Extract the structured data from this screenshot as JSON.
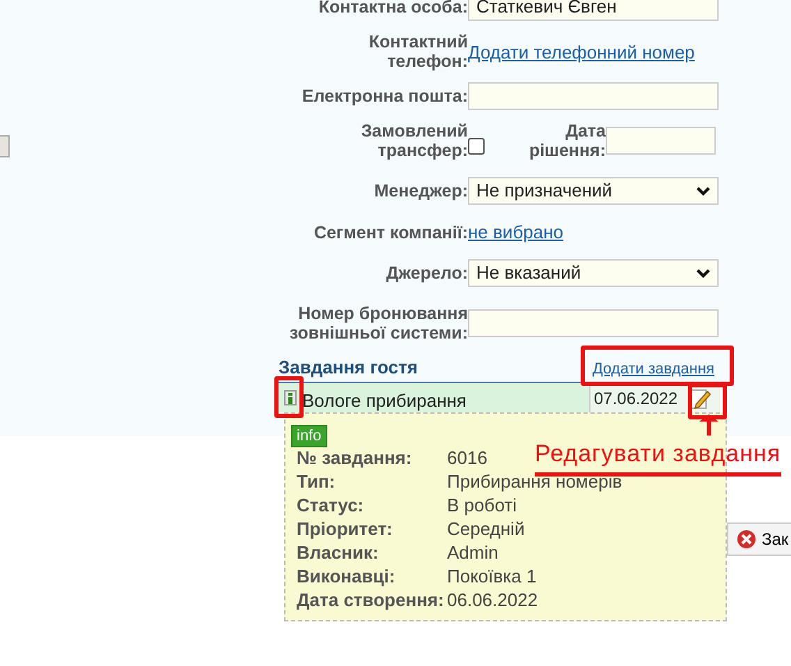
{
  "form": {
    "rows": [
      {
        "kind": "input",
        "label": "Контактна особа:",
        "value": "Статкевич Євген"
      },
      {
        "kind": "link",
        "label": "Контактний телефон:",
        "link": "Додати телефонний номер"
      },
      {
        "kind": "input",
        "label": "Електронна пошта:"
      },
      {
        "kind": "checkbox",
        "label": "Замовлений трансфер:",
        "checked": false,
        "date_label": "Дата рішення:"
      },
      {
        "kind": "select",
        "label": "Менеджер:",
        "value": "Не призначений"
      },
      {
        "kind": "link",
        "label": "Сегмент компанії:",
        "link": "не вибрано"
      },
      {
        "kind": "select",
        "label": "Джерело:",
        "value": "Не вказаний"
      },
      {
        "kind": "input",
        "label": "Номер бронювання зовнішньої системи:"
      }
    ]
  },
  "tasks": {
    "title": "Завдання гостя",
    "add_link": "Додати завдання",
    "items": [
      {
        "name": "Вологе прибирання",
        "date": "07.06.2022"
      }
    ]
  },
  "tooltip": {
    "badge": "info",
    "fields": [
      {
        "label": "№ завдання:",
        "value": "6016"
      },
      {
        "label": "Тип:",
        "value": "Прибирання номерів"
      },
      {
        "label": "Статус:",
        "value": "В роботі"
      },
      {
        "label": "Пріоритет:",
        "value": "Середній"
      },
      {
        "label": "Власник:",
        "value": "Admin"
      },
      {
        "label": "Виконавці:",
        "value": "Покоївка 1"
      },
      {
        "label": "Дата створення:",
        "value": "06.06.2022"
      }
    ]
  },
  "annotation": {
    "text": "Редагувати завдання"
  },
  "close_button": {
    "label": "Зак"
  }
}
